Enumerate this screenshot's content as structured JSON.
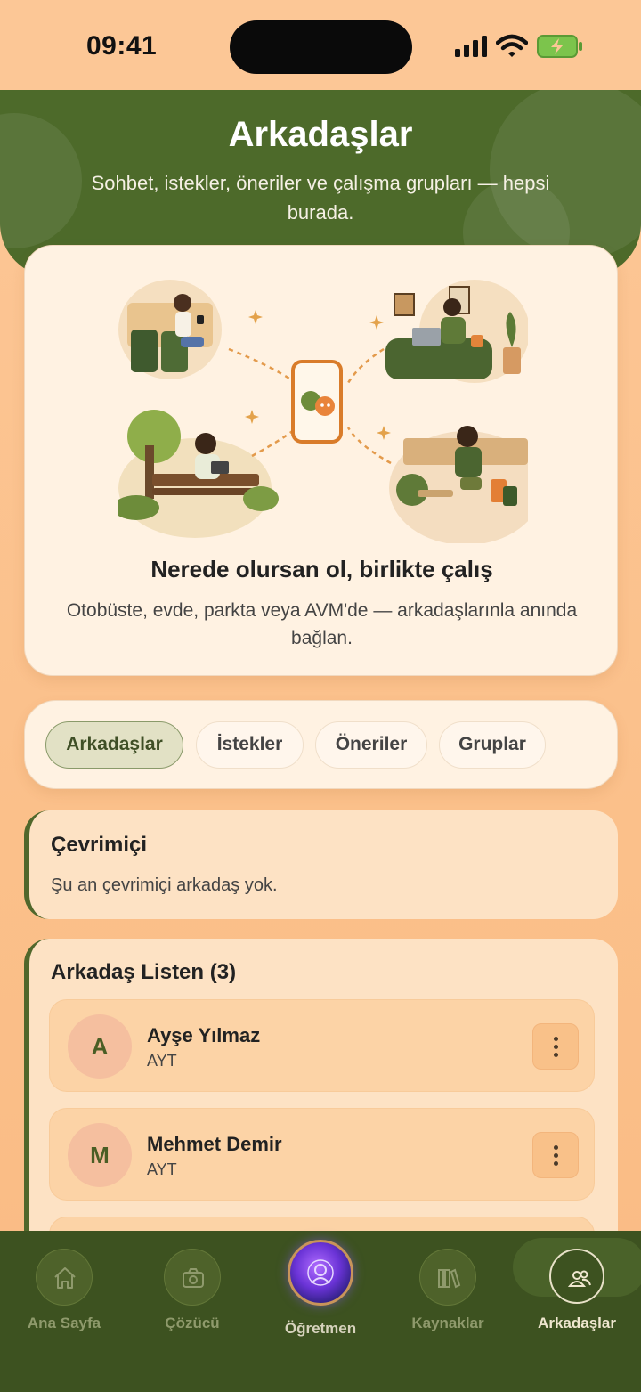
{
  "status_bar": {
    "time": "09:41"
  },
  "header": {
    "title": "Arkadaşlar",
    "subtitle": "Sohbet, istekler, öneriler ve çalışma grupları — hepsi burada."
  },
  "hero": {
    "title": "Nerede olursan ol, birlikte çalış",
    "subtitle": "Otobüste, evde, parkta veya AVM'de — arkadaşlarınla anında bağlan."
  },
  "tabs": [
    {
      "label": "Arkadaşlar",
      "active": true
    },
    {
      "label": "İstekler",
      "active": false
    },
    {
      "label": "Öneriler",
      "active": false
    },
    {
      "label": "Gruplar",
      "active": false
    }
  ],
  "online": {
    "title": "Çevrimiçi",
    "empty_text": "Şu an çevrimiçi arkadaş yok."
  },
  "friends": {
    "title": "Arkadaş Listen (3)",
    "items": [
      {
        "initial": "A",
        "name": "Ayşe Yılmaz",
        "sub": "AYT"
      },
      {
        "initial": "M",
        "name": "Mehmet Demir",
        "sub": "AYT"
      }
    ]
  },
  "bottom_nav": {
    "items": [
      {
        "label": "Ana Sayfa",
        "icon": "home-icon"
      },
      {
        "label": "Çözücü",
        "icon": "camera-icon"
      },
      {
        "label": "Öğretmen",
        "icon": "teacher-orb-icon"
      },
      {
        "label": "Kaynaklar",
        "icon": "books-icon"
      },
      {
        "label": "Arkadaşlar",
        "icon": "friends-icon",
        "active": true
      }
    ]
  },
  "colors": {
    "background": "#fbc48f",
    "header_green": "#4d6a2a",
    "nav_green": "#3d5220",
    "card": "#fff2e2",
    "active_tab": "#e2e1c5"
  }
}
